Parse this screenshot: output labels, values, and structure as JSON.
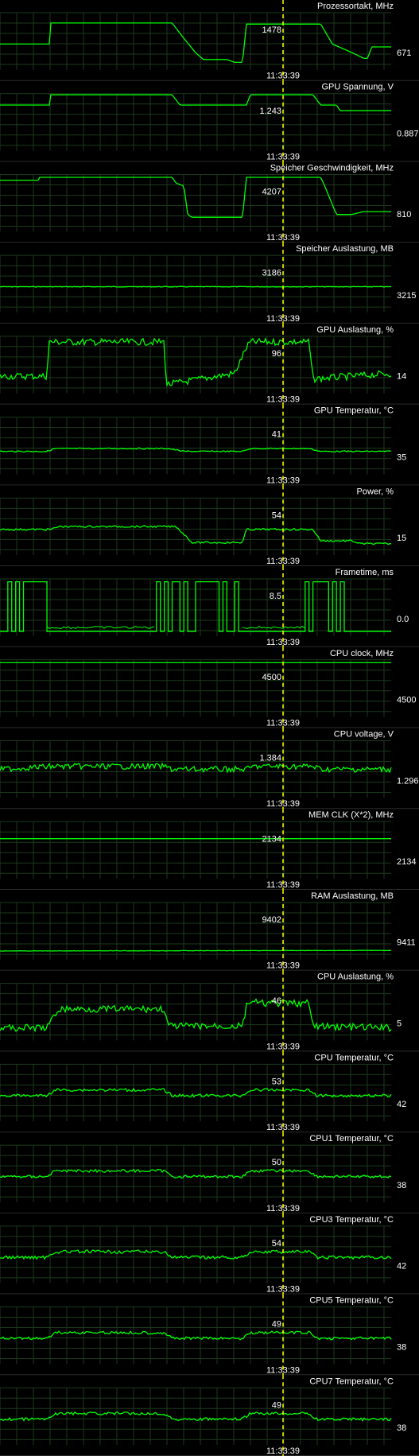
{
  "timestamp": "11:33:39",
  "colors": {
    "background": "#000000",
    "grid": "#1c3a1c",
    "trace": "#00ff00",
    "cursor": "#ffff00",
    "text": "#ffffff"
  },
  "graphs": [
    {
      "id": "prozessortakt",
      "title": "Prozessortakt, MHz",
      "cursor_value": "1478",
      "current_value": "671"
    },
    {
      "id": "gpu-spannung",
      "title": "GPU Spannung, V",
      "cursor_value": "1.243",
      "current_value": "0.887"
    },
    {
      "id": "speicher-geschwindigkeit",
      "title": "Speicher Geschwindigkeit, MHz",
      "cursor_value": "4207",
      "current_value": "810"
    },
    {
      "id": "speicher-auslastung",
      "title": "Speicher Auslastung, MB",
      "cursor_value": "3186",
      "current_value": "3215"
    },
    {
      "id": "gpu-auslastung",
      "title": "GPU Auslastung, %",
      "cursor_value": "96",
      "current_value": "14"
    },
    {
      "id": "gpu-temperatur",
      "title": "GPU Temperatur, °C",
      "cursor_value": "41",
      "current_value": "35"
    },
    {
      "id": "power",
      "title": "Power, %",
      "cursor_value": "54",
      "current_value": "15"
    },
    {
      "id": "frametime",
      "title": "Frametime, ms",
      "cursor_value": "8.5",
      "current_value": "0.0"
    },
    {
      "id": "cpu-clock",
      "title": "CPU clock, MHz",
      "cursor_value": "4500",
      "current_value": "4500"
    },
    {
      "id": "cpu-voltage",
      "title": "CPU voltage, V",
      "cursor_value": "1.384",
      "current_value": "1.296"
    },
    {
      "id": "mem-clk",
      "title": "MEM CLK (X*2), MHz",
      "cursor_value": "2134",
      "current_value": "2134"
    },
    {
      "id": "ram-auslastung",
      "title": "RAM Auslastung, MB",
      "cursor_value": "9402",
      "current_value": "9411"
    },
    {
      "id": "cpu-auslastung",
      "title": "CPU Auslastung, %",
      "cursor_value": "46",
      "current_value": "5"
    },
    {
      "id": "cpu-temperatur",
      "title": "CPU Temperatur, °C",
      "cursor_value": "53",
      "current_value": "42"
    },
    {
      "id": "cpu1-temperatur",
      "title": "CPU1 Temperatur, °C",
      "cursor_value": "50",
      "current_value": "38"
    },
    {
      "id": "cpu3-temperatur",
      "title": "CPU3 Temperatur, °C",
      "cursor_value": "54",
      "current_value": "42"
    },
    {
      "id": "cpu5-temperatur",
      "title": "CPU5 Temperatur, °C",
      "cursor_value": "49",
      "current_value": "38"
    },
    {
      "id": "cpu7-temperatur",
      "title": "CPU7 Temperatur, °C",
      "cursor_value": "49",
      "current_value": "38"
    }
  ]
}
